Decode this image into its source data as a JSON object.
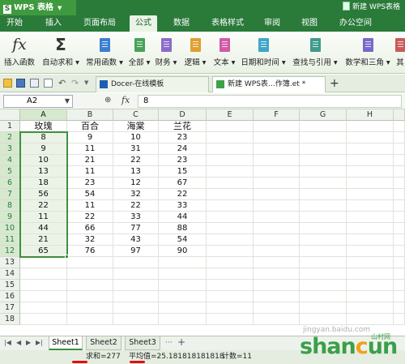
{
  "titlebar": {
    "app_name": "WPS 表格",
    "doc_title": "新建 WPS表格"
  },
  "menu": {
    "tabs": [
      "开始",
      "插入",
      "页面布局",
      "公式",
      "数据",
      "表格样式",
      "审阅",
      "视图",
      "办公空间"
    ],
    "active": "公式"
  },
  "ribbon": {
    "insert_function": "插入函数",
    "autosum": "自动求和",
    "common_functions": "常用函数",
    "all": "全部",
    "finance": "财务",
    "logic": "逻辑",
    "text": "文本",
    "datetime": "日期和时间",
    "lookup": "查找与引用",
    "math_trig": "数学和三角",
    "more": "其"
  },
  "doc_tabs": {
    "tab1": "Docer-在线模板",
    "tab2": "新建 WPS表…作簿.et *"
  },
  "formula_bar": {
    "cell_ref": "A2",
    "fx": "fx",
    "value": "8"
  },
  "grid": {
    "columns": [
      "A",
      "B",
      "C",
      "D",
      "E",
      "F",
      "G",
      "H"
    ],
    "rows": [
      "1",
      "2",
      "3",
      "4",
      "5",
      "6",
      "7",
      "8",
      "9",
      "10",
      "11",
      "12",
      "13",
      "14",
      "15",
      "16",
      "17",
      "18"
    ],
    "headers": [
      "玫瑰",
      "百合",
      "海棠",
      "兰花"
    ],
    "data": [
      [
        "8",
        "9",
        "10",
        "23"
      ],
      [
        "9",
        "11",
        "31",
        "24"
      ],
      [
        "10",
        "21",
        "22",
        "23"
      ],
      [
        "13",
        "11",
        "13",
        "15"
      ],
      [
        "18",
        "23",
        "12",
        "67"
      ],
      [
        "56",
        "54",
        "32",
        "22"
      ],
      [
        "22",
        "11",
        "22",
        "33"
      ],
      [
        "11",
        "22",
        "33",
        "44"
      ],
      [
        "44",
        "66",
        "77",
        "88"
      ],
      [
        "21",
        "32",
        "43",
        "54"
      ],
      [
        "65",
        "76",
        "97",
        "90"
      ]
    ]
  },
  "sheets": {
    "tabs": [
      "Sheet1",
      "Sheet2",
      "Sheet3"
    ],
    "active": "Sheet1"
  },
  "status": {
    "sum": "求和=277",
    "avg": "平均值=25.181818181818",
    "count": "计数=11"
  },
  "watermark": {
    "brand": "shancun",
    "suffix": "山村网",
    "site": "jingyan.baidu.com"
  },
  "colors": {
    "accent": "#2a7a3a",
    "selection": "#3f8f3f",
    "redmark": "#e01010"
  }
}
